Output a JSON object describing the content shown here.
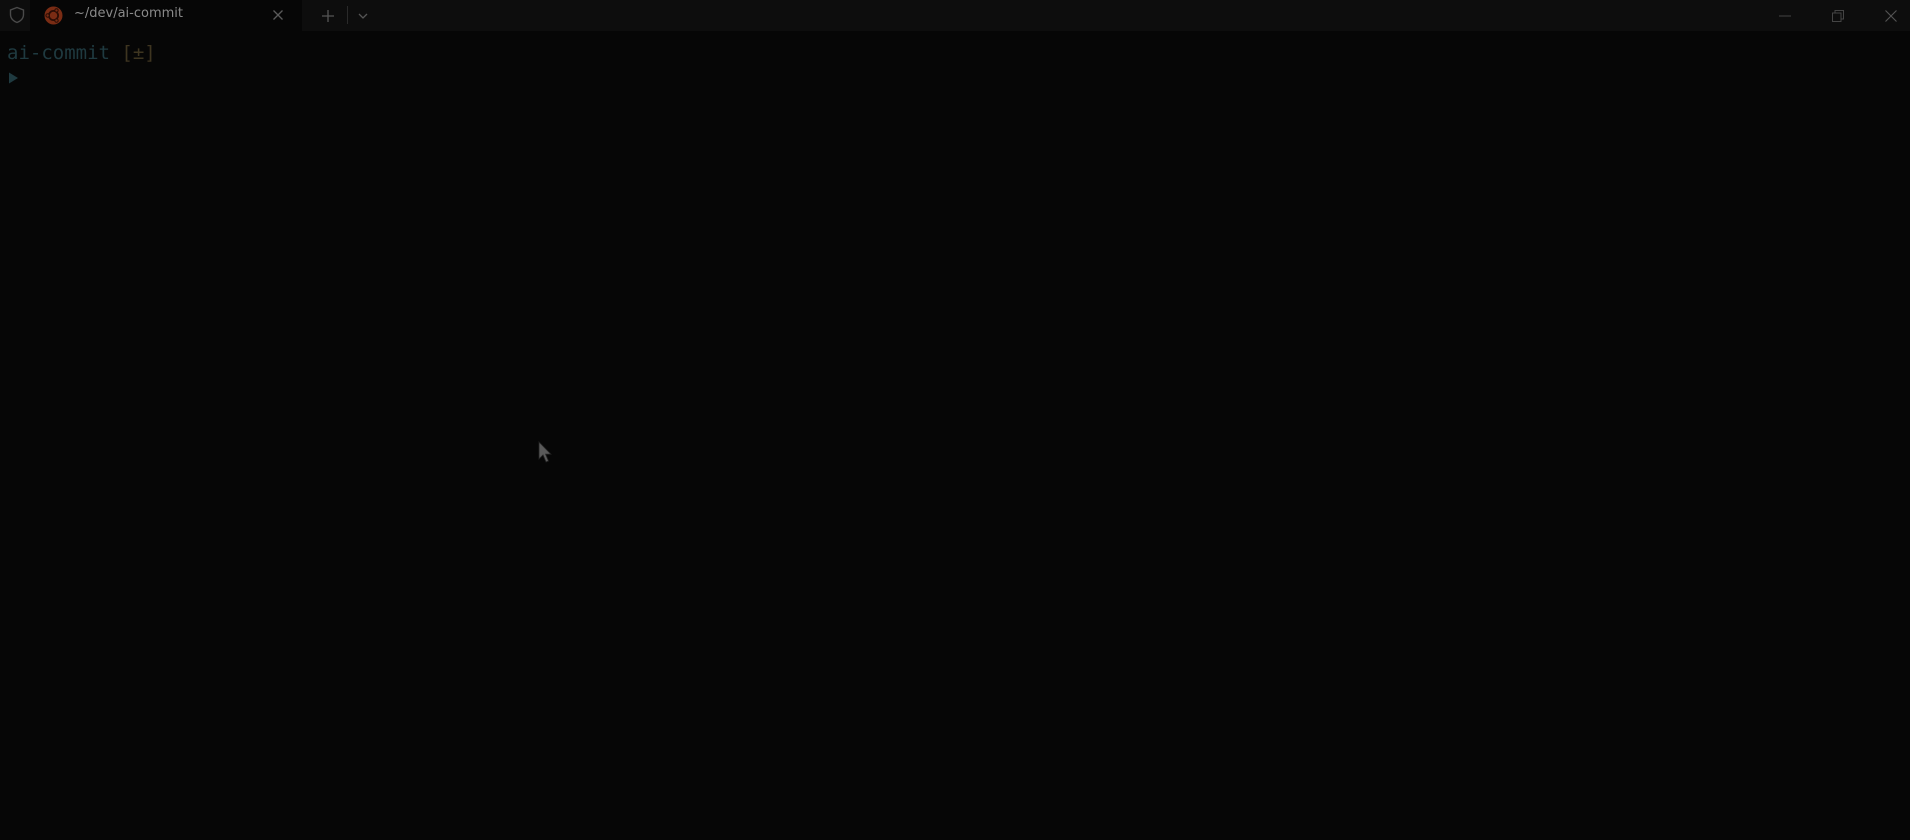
{
  "window": {
    "tab": {
      "title": "~/dev/ai-commit",
      "icon": "ubuntu-icon"
    },
    "icons": {
      "shield": "shield-icon",
      "close_tab": "close-icon",
      "new_tab": "plus-icon",
      "dropdown": "chevron-down-icon",
      "minimize": "minimize-icon",
      "maximize": "restore-icon",
      "close": "close-icon"
    }
  },
  "terminal": {
    "prompt_dir": "ai-commit",
    "prompt_status": "[±]",
    "prompt_symbol": "▶"
  },
  "colors": {
    "background": "#060606",
    "titlebar": "#0d0d0d",
    "prompt_dir": "#1f3a40",
    "prompt_status": "#3e3520",
    "ubuntu_orange": "#7a2c14"
  }
}
